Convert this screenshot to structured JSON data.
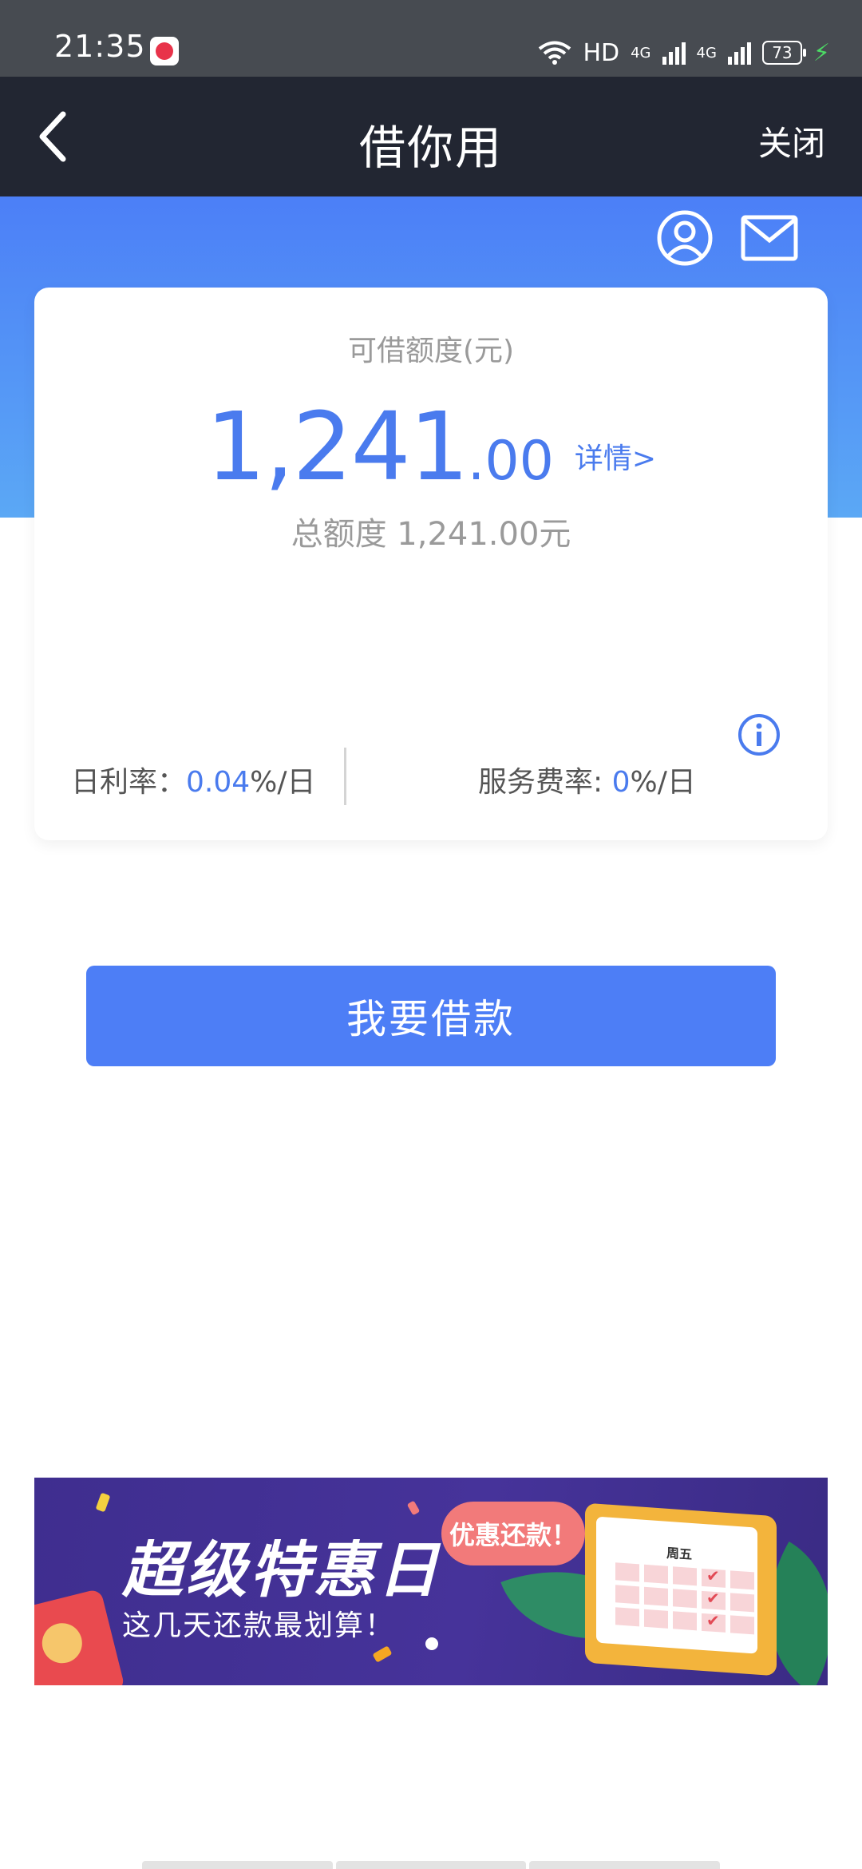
{
  "status_bar": {
    "time": "21:35",
    "network_label": "HD",
    "signal1_label": "4G",
    "signal2_label": "4G",
    "battery": "73"
  },
  "nav": {
    "title": "借你用",
    "close_label": "关闭"
  },
  "header_icons": [
    "user-icon",
    "mail-icon"
  ],
  "card": {
    "label": "可借额度(元)",
    "amount_int": "1,241",
    "amount_dec": ".00",
    "detail_link": "详情>",
    "total_line": "总额度 1,241.00元",
    "rate_left_label": "日利率：",
    "rate_left_value": "0.04",
    "rate_left_unit": "%/日",
    "rate_right_label": "服务费率: ",
    "rate_right_value": "0",
    "rate_right_unit": "%/日"
  },
  "borrow_button": "我要借款",
  "banner": {
    "title": "超级特惠日",
    "subtitle": "这几天还款最划算！",
    "pill": "优惠还款！",
    "calendar_day": "周五"
  },
  "colors": {
    "accent": "#4d7ef6",
    "nav_bg": "#222632",
    "status_bg": "#474b51"
  }
}
